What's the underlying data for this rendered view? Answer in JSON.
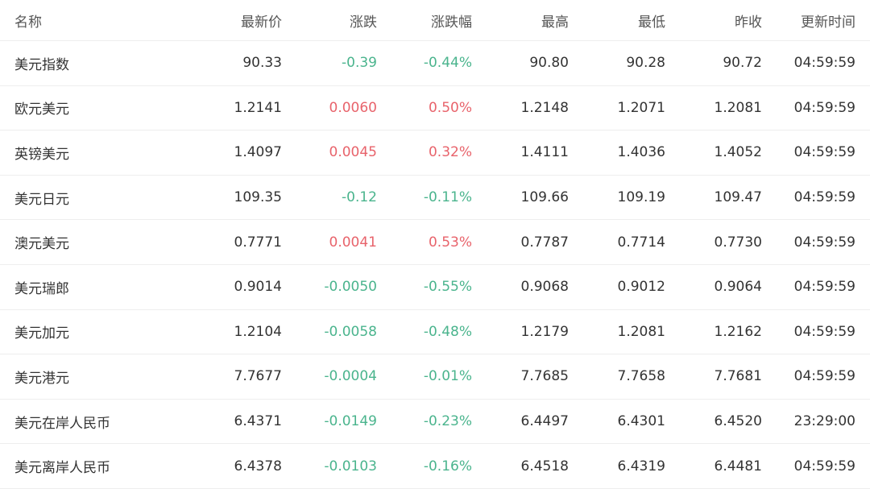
{
  "headers": [
    "名称",
    "最新价",
    "涨跌",
    "涨跌幅",
    "最高",
    "最低",
    "昨收",
    "更新时间"
  ],
  "colors": {
    "up": "#e8636b",
    "down": "#4ab48d",
    "text": "#333333"
  },
  "rows": [
    {
      "name": "美元指数",
      "price": "90.33",
      "change": "-0.39",
      "pct": "-0.44%",
      "high": "90.80",
      "low": "90.28",
      "prev": "90.72",
      "time": "04:59:59",
      "dir": "down"
    },
    {
      "name": "欧元美元",
      "price": "1.2141",
      "change": "0.0060",
      "pct": "0.50%",
      "high": "1.2148",
      "low": "1.2071",
      "prev": "1.2081",
      "time": "04:59:59",
      "dir": "up"
    },
    {
      "name": "英镑美元",
      "price": "1.4097",
      "change": "0.0045",
      "pct": "0.32%",
      "high": "1.4111",
      "low": "1.4036",
      "prev": "1.4052",
      "time": "04:59:59",
      "dir": "up"
    },
    {
      "name": "美元日元",
      "price": "109.35",
      "change": "-0.12",
      "pct": "-0.11%",
      "high": "109.66",
      "low": "109.19",
      "prev": "109.47",
      "time": "04:59:59",
      "dir": "down"
    },
    {
      "name": "澳元美元",
      "price": "0.7771",
      "change": "0.0041",
      "pct": "0.53%",
      "high": "0.7787",
      "low": "0.7714",
      "prev": "0.7730",
      "time": "04:59:59",
      "dir": "up"
    },
    {
      "name": "美元瑞郎",
      "price": "0.9014",
      "change": "-0.0050",
      "pct": "-0.55%",
      "high": "0.9068",
      "low": "0.9012",
      "prev": "0.9064",
      "time": "04:59:59",
      "dir": "down"
    },
    {
      "name": "美元加元",
      "price": "1.2104",
      "change": "-0.0058",
      "pct": "-0.48%",
      "high": "1.2179",
      "low": "1.2081",
      "prev": "1.2162",
      "time": "04:59:59",
      "dir": "down"
    },
    {
      "name": "美元港元",
      "price": "7.7677",
      "change": "-0.0004",
      "pct": "-0.01%",
      "high": "7.7685",
      "low": "7.7658",
      "prev": "7.7681",
      "time": "04:59:59",
      "dir": "down"
    },
    {
      "name": "美元在岸人民币",
      "price": "6.4371",
      "change": "-0.0149",
      "pct": "-0.23%",
      "high": "6.4497",
      "low": "6.4301",
      "prev": "6.4520",
      "time": "23:29:00",
      "dir": "down"
    },
    {
      "name": "美元离岸人民币",
      "price": "6.4378",
      "change": "-0.0103",
      "pct": "-0.16%",
      "high": "6.4518",
      "low": "6.4319",
      "prev": "6.4481",
      "time": "04:59:59",
      "dir": "down"
    }
  ]
}
